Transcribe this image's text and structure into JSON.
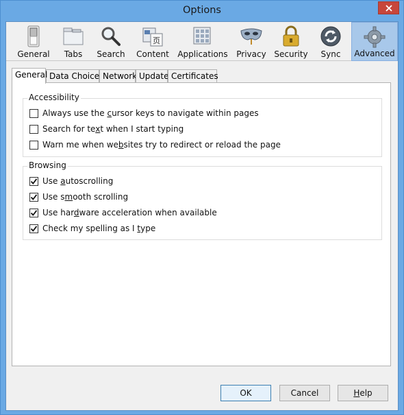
{
  "window": {
    "title": "Options"
  },
  "toolbar": {
    "panes": [
      {
        "label": "General",
        "icon": "switch-icon"
      },
      {
        "label": "Tabs",
        "icon": "tabs-icon"
      },
      {
        "label": "Search",
        "icon": "magnifier-icon"
      },
      {
        "label": "Content",
        "icon": "content-icon"
      },
      {
        "label": "Applications",
        "icon": "applications-icon"
      },
      {
        "label": "Privacy",
        "icon": "mask-icon"
      },
      {
        "label": "Security",
        "icon": "padlock-icon"
      },
      {
        "label": "Sync",
        "icon": "sync-icon"
      },
      {
        "label": "Advanced",
        "icon": "gear-icon",
        "active": true
      }
    ]
  },
  "tabs": [
    {
      "label": "General",
      "active": true
    },
    {
      "label": "Data Choices"
    },
    {
      "label": "Network"
    },
    {
      "label": "Update"
    },
    {
      "label": "Certificates"
    }
  ],
  "accessibility": {
    "legend": "Accessibility",
    "options": [
      {
        "pre": "Always use the ",
        "key": "c",
        "post": "ursor keys to navigate within pages",
        "checked": false
      },
      {
        "pre": "Search for te",
        "key": "x",
        "post": "t when I start typing",
        "checked": false
      },
      {
        "pre": "Warn me when we",
        "key": "b",
        "post": "sites try to redirect or reload the page",
        "checked": false
      }
    ]
  },
  "browsing": {
    "legend": "Browsing",
    "options": [
      {
        "pre": "Use ",
        "key": "a",
        "post": "utoscrolling",
        "checked": true
      },
      {
        "pre": "Use s",
        "key": "m",
        "post": "ooth scrolling",
        "checked": true
      },
      {
        "pre": "Use har",
        "key": "d",
        "post": "ware acceleration when available",
        "checked": true
      },
      {
        "pre": "Check my spelling as I ",
        "key": "t",
        "post": "ype",
        "checked": true
      }
    ]
  },
  "buttons": {
    "ok": "OK",
    "cancel": "Cancel",
    "help_key": "H",
    "help_rest": "elp"
  },
  "colors": {
    "accent": "#6aa9e4",
    "active_pane": "#a8c8ea",
    "close": "#c7463b"
  }
}
